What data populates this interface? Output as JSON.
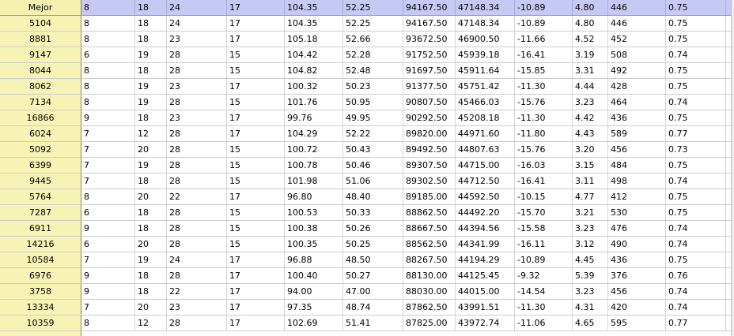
{
  "table": {
    "rows": [
      {
        "label": "Mejor",
        "selected": true,
        "cells": [
          "8",
          "18",
          "24",
          "17",
          "104.35",
          "52.25",
          "94167.50",
          "47148.34",
          "-10.89",
          "4.80",
          "446",
          "0.75"
        ]
      },
      {
        "label": "5104",
        "selected": false,
        "cells": [
          "8",
          "18",
          "24",
          "17",
          "104.35",
          "52.25",
          "94167.50",
          "47148.34",
          "-10.89",
          "4.80",
          "446",
          "0.75"
        ]
      },
      {
        "label": "8881",
        "selected": false,
        "cells": [
          "8",
          "18",
          "23",
          "17",
          "105.18",
          "52.66",
          "93672.50",
          "46900.50",
          "-11.66",
          "4.52",
          "452",
          "0.75"
        ]
      },
      {
        "label": "9147",
        "selected": false,
        "cells": [
          "6",
          "19",
          "28",
          "15",
          "104.42",
          "52.28",
          "91752.50",
          "45939.18",
          "-16.41",
          "3.19",
          "508",
          "0.74"
        ]
      },
      {
        "label": "8044",
        "selected": false,
        "cells": [
          "8",
          "18",
          "28",
          "15",
          "104.82",
          "52.48",
          "91697.50",
          "45911.64",
          "-15.85",
          "3.31",
          "492",
          "0.75"
        ]
      },
      {
        "label": "8062",
        "selected": false,
        "cells": [
          "8",
          "19",
          "23",
          "17",
          "100.32",
          "50.23",
          "91377.50",
          "45751.42",
          "-11.30",
          "4.44",
          "428",
          "0.75"
        ]
      },
      {
        "label": "7134",
        "selected": false,
        "cells": [
          "8",
          "19",
          "28",
          "15",
          "101.76",
          "50.95",
          "90807.50",
          "45466.03",
          "-15.76",
          "3.23",
          "464",
          "0.74"
        ]
      },
      {
        "label": "16866",
        "selected": false,
        "cells": [
          "9",
          "18",
          "23",
          "17",
          "99.76",
          "49.95",
          "90292.50",
          "45208.18",
          "-11.30",
          "4.42",
          "436",
          "0.75"
        ]
      },
      {
        "label": "6024",
        "selected": false,
        "cells": [
          "7",
          "12",
          "28",
          "17",
          "104.29",
          "52.22",
          "89820.00",
          "44971.60",
          "-11.80",
          "4.43",
          "589",
          "0.77"
        ]
      },
      {
        "label": "5092",
        "selected": false,
        "cells": [
          "7",
          "20",
          "28",
          "15",
          "100.72",
          "50.43",
          "89492.50",
          "44807.63",
          "-15.76",
          "3.20",
          "456",
          "0.73"
        ]
      },
      {
        "label": "6399",
        "selected": false,
        "cells": [
          "7",
          "19",
          "28",
          "15",
          "100.78",
          "50.46",
          "89307.50",
          "44715.00",
          "-16.03",
          "3.15",
          "484",
          "0.75"
        ]
      },
      {
        "label": "9445",
        "selected": false,
        "cells": [
          "7",
          "18",
          "28",
          "15",
          "101.98",
          "51.06",
          "89302.50",
          "44712.50",
          "-16.41",
          "3.11",
          "498",
          "0.74"
        ]
      },
      {
        "label": "5764",
        "selected": false,
        "cells": [
          "8",
          "20",
          "22",
          "17",
          "96.80",
          "48.40",
          "89185.00",
          "44592.50",
          "-10.15",
          "4.77",
          "412",
          "0.75"
        ]
      },
      {
        "label": "7287",
        "selected": false,
        "cells": [
          "6",
          "18",
          "28",
          "15",
          "100.53",
          "50.33",
          "88862.50",
          "44492.20",
          "-15.70",
          "3.21",
          "530",
          "0.75"
        ]
      },
      {
        "label": "6911",
        "selected": false,
        "cells": [
          "9",
          "18",
          "28",
          "15",
          "100.38",
          "50.26",
          "88667.50",
          "44394.56",
          "-15.58",
          "3.23",
          "476",
          "0.74"
        ]
      },
      {
        "label": "14216",
        "selected": false,
        "cells": [
          "6",
          "20",
          "28",
          "15",
          "100.35",
          "50.25",
          "88562.50",
          "44341.99",
          "-16.11",
          "3.12",
          "490",
          "0.74"
        ]
      },
      {
        "label": "10584",
        "selected": false,
        "cells": [
          "7",
          "19",
          "24",
          "17",
          "96.88",
          "48.50",
          "88267.50",
          "44194.29",
          "-10.89",
          "4.45",
          "436",
          "0.75"
        ]
      },
      {
        "label": "6976",
        "selected": false,
        "cells": [
          "9",
          "18",
          "28",
          "17",
          "100.40",
          "50.27",
          "88130.00",
          "44125.45",
          "-9.32",
          "5.39",
          "376",
          "0.76"
        ]
      },
      {
        "label": "3758",
        "selected": false,
        "cells": [
          "9",
          "18",
          "22",
          "17",
          "94.00",
          "47.00",
          "88030.00",
          "44015.00",
          "-14.54",
          "3.23",
          "456",
          "0.74"
        ]
      },
      {
        "label": "13334",
        "selected": false,
        "cells": [
          "7",
          "20",
          "23",
          "17",
          "97.35",
          "48.74",
          "87862.50",
          "43991.51",
          "-11.30",
          "4.31",
          "420",
          "0.74"
        ]
      },
      {
        "label": "10359",
        "selected": false,
        "cells": [
          "8",
          "12",
          "28",
          "17",
          "102.69",
          "51.41",
          "87825.00",
          "43972.74",
          "-11.06",
          "4.65",
          "595",
          "0.77"
        ]
      }
    ]
  }
}
